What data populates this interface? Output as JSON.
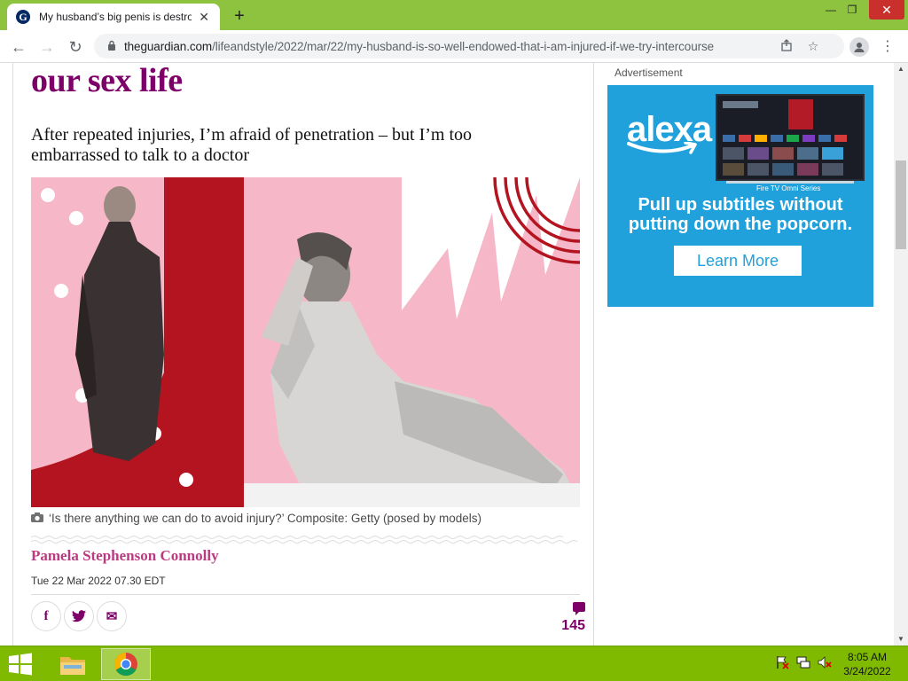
{
  "browser": {
    "tab_title": "My husband’s big penis is destroying our sex life",
    "tab_close": "✕",
    "new_tab": "+",
    "url_host": "theguardian.com",
    "url_path": "/lifeandstyle/2022/mar/22/my-husband-is-so-well-endowed-that-i-am-injured-if-we-try-intercourse",
    "window": {
      "minimize": "—",
      "maximize": "❐",
      "close": "✕"
    }
  },
  "article": {
    "headline": "our sex life",
    "standfirst": "After repeated injuries, I’m afraid of penetration – but I’m too embarrassed to talk to a doctor",
    "caption": "‘Is there anything we can do to avoid injury?’ Composite: Getty (posed by models)",
    "author": "Pamela Stephenson Connolly",
    "date": "Tue 22 Mar 2022 07.30 EDT",
    "share": {
      "facebook": "f",
      "twitter": "t",
      "email": "✉"
    },
    "comment_count": "145"
  },
  "ad": {
    "label": "Advertisement",
    "brand": "alexa",
    "tv_caption": "Fire TV Omni Series",
    "line1": "Pull up subtitles without",
    "line2": "putting down the popcorn.",
    "cta": "Learn More",
    "background_color": "#21a1dc"
  },
  "taskbar": {
    "time": "8:05 AM",
    "date": "3/24/2022"
  },
  "colors": {
    "headline": "#7d0068",
    "byline": "#bb3b80",
    "taskbar": "#7fba00",
    "titlebar": "#8dc33f"
  }
}
